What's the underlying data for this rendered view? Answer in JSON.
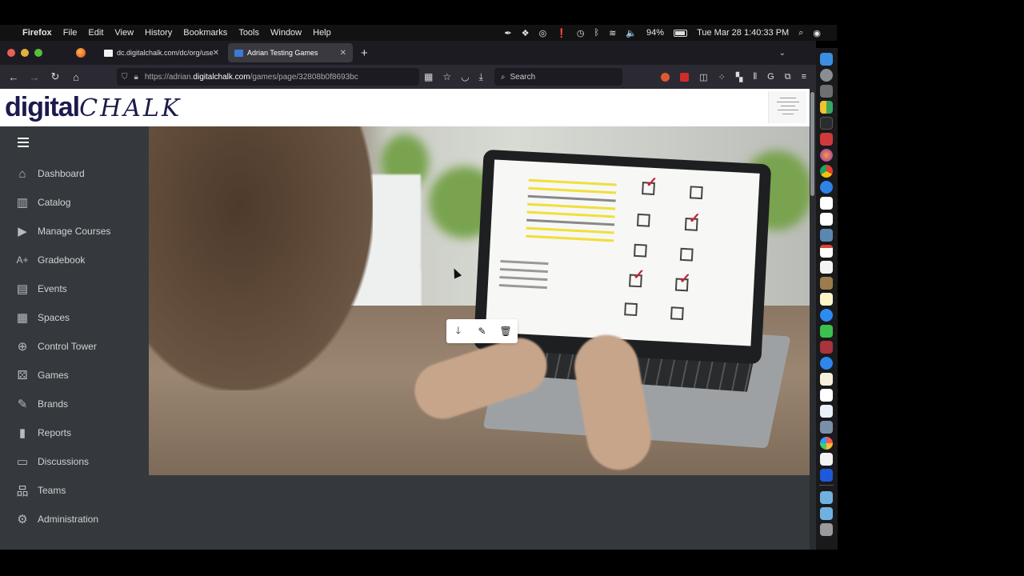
{
  "menubar": {
    "apple": "",
    "items": [
      "Firefox",
      "File",
      "Edit",
      "View",
      "History",
      "Bookmarks",
      "Tools",
      "Window",
      "Help"
    ],
    "status": {
      "battery": "94%",
      "datetime": "Tue Mar 28  1:40:33 PM"
    },
    "status_icons": [
      "feather-icon",
      "dropbox-icon",
      "airplay-icon",
      "alert-icon",
      "time-machine-icon",
      "bluetooth-icon",
      "wifi-icon",
      "volume-icon",
      "battery-icon",
      "spotlight-icon",
      "siri-icon"
    ]
  },
  "browser": {
    "tabs": [
      {
        "title": "dc.digitalchalk.com/dc/org/user",
        "active": false
      },
      {
        "title": "Adrian Testing Games",
        "active": true
      }
    ],
    "new_tab": "+",
    "tab_close": "✕",
    "url": {
      "prefix": "https://adrian.",
      "domain": "digitalchalk.com",
      "path": "/games/page/32808b0f8693bc"
    },
    "search_placeholder": "Search"
  },
  "app": {
    "logo_main": "digital",
    "logo_script": "CHALK",
    "sidebar": {
      "items": [
        {
          "label": "Dashboard",
          "icon": "⌂"
        },
        {
          "label": "Catalog",
          "icon": "▥"
        },
        {
          "label": "Manage Courses",
          "icon": "▶"
        },
        {
          "label": "Gradebook",
          "icon": "A+"
        },
        {
          "label": "Events",
          "icon": "▤"
        },
        {
          "label": "Spaces",
          "icon": "▦"
        },
        {
          "label": "Control Tower",
          "icon": "⊕"
        },
        {
          "label": "Games",
          "icon": "⚄"
        },
        {
          "label": "Brands",
          "icon": "✎"
        },
        {
          "label": "Reports",
          "icon": "▮"
        },
        {
          "label": "Discussions",
          "icon": "▭"
        },
        {
          "label": "Teams",
          "icon": "品"
        },
        {
          "label": "Administration",
          "icon": "⚙"
        }
      ]
    },
    "image_toolbar": {
      "download": "🡓",
      "edit": "✎",
      "delete": "🗑"
    }
  }
}
